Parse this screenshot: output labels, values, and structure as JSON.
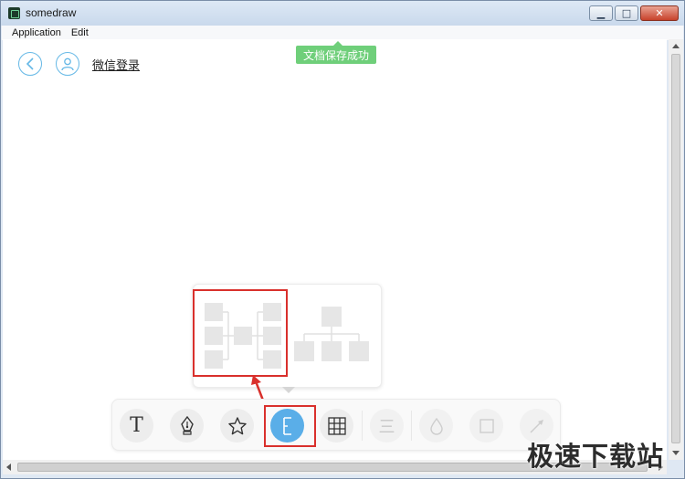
{
  "window": {
    "title": "somedraw",
    "controls": {
      "minimize_icon": "minimize-icon",
      "maximize_icon": "maximize-icon",
      "close_icon": "close-icon"
    }
  },
  "menu": {
    "items": [
      "Application",
      "Edit"
    ]
  },
  "header": {
    "back_icon": "back-arrow-icon",
    "user_icon": "user-icon",
    "login_label": "微信登录"
  },
  "toast": {
    "message": "文档保存成功",
    "color": "#6fcf7a"
  },
  "layout_popup": {
    "options": [
      {
        "name": "horizontal-tree-layout",
        "selected": true
      },
      {
        "name": "org-chart-layout",
        "selected": false
      }
    ]
  },
  "toolbar": {
    "tools": [
      {
        "name": "text-tool",
        "glyph": "T",
        "state": "normal"
      },
      {
        "name": "pen-tool",
        "icon": "pen-nib-icon",
        "state": "normal"
      },
      {
        "name": "star-tool",
        "icon": "star-icon",
        "state": "normal"
      },
      {
        "name": "mindmap-tool",
        "glyph": "E",
        "state": "active"
      },
      {
        "name": "table-tool",
        "icon": "grid-icon",
        "state": "normal"
      },
      {
        "name": "list-tool",
        "glyph": "三",
        "state": "disabled"
      },
      {
        "name": "fill-tool",
        "icon": "droplet-icon",
        "state": "disabled"
      },
      {
        "name": "border-tool",
        "icon": "square-icon",
        "state": "disabled"
      },
      {
        "name": "line-tool",
        "icon": "arrow-line-icon",
        "state": "disabled"
      }
    ]
  },
  "accent_color": "#5aaee8",
  "annotation_color": "#d9302c",
  "watermark": "极速下载站"
}
